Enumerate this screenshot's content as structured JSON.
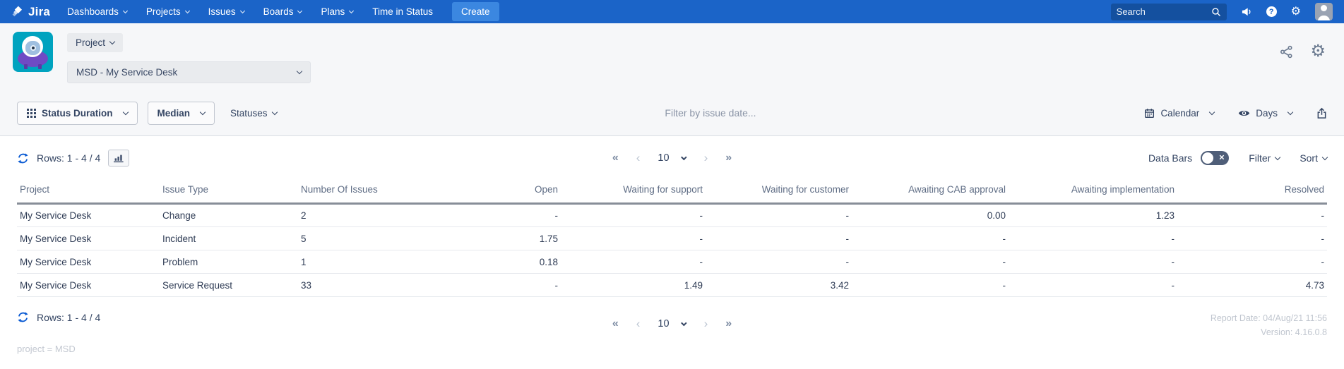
{
  "navbar": {
    "logo_text": "Jira",
    "items": [
      {
        "label": "Dashboards",
        "dropdown": true
      },
      {
        "label": "Projects",
        "dropdown": true
      },
      {
        "label": "Issues",
        "dropdown": true
      },
      {
        "label": "Boards",
        "dropdown": true
      },
      {
        "label": "Plans",
        "dropdown": true
      },
      {
        "label": "Time in Status",
        "dropdown": false
      }
    ],
    "create_label": "Create",
    "search_placeholder": "Search"
  },
  "icons": {
    "help_glyph": "?",
    "gear_glyph": "⚙",
    "cross_glyph": "✕"
  },
  "project_header": {
    "scope_label": "Project",
    "project_value": "MSD - My Service Desk"
  },
  "toolbar": {
    "report_type_label": "Status Duration",
    "metric_label": "Median",
    "statuses_label": "Statuses",
    "date_filter_placeholder": "Filter by issue date...",
    "calendar_label": "Calendar",
    "unit_label": "Days"
  },
  "list_controls": {
    "rows_label": "Rows: 1 - 4 / 4",
    "data_bars_label": "Data Bars",
    "data_bars_state": "off",
    "filter_label": "Filter",
    "sort_label": "Sort"
  },
  "pagination": {
    "first": "«",
    "prev": "‹",
    "page_size": "10",
    "next": "›",
    "last": "»"
  },
  "table": {
    "columns": [
      {
        "label": "Project",
        "align": "left"
      },
      {
        "label": "Issue Type",
        "align": "left"
      },
      {
        "label": "Number Of Issues",
        "align": "left"
      },
      {
        "label": "Open",
        "align": "right"
      },
      {
        "label": "Waiting for support",
        "align": "right"
      },
      {
        "label": "Waiting for customer",
        "align": "right"
      },
      {
        "label": "Awaiting CAB approval",
        "align": "right"
      },
      {
        "label": "Awaiting implementation",
        "align": "right"
      },
      {
        "label": "Resolved",
        "align": "right"
      }
    ],
    "rows": [
      [
        "My Service Desk",
        "Change",
        "2",
        "-",
        "-",
        "-",
        "0.00",
        "1.23",
        "-"
      ],
      [
        "My Service Desk",
        "Incident",
        "5",
        "1.75",
        "-",
        "-",
        "-",
        "-",
        "-"
      ],
      [
        "My Service Desk",
        "Problem",
        "1",
        "0.18",
        "-",
        "-",
        "-",
        "-",
        "-"
      ],
      [
        "My Service Desk",
        "Service Request",
        "33",
        "-",
        "1.49",
        "3.42",
        "-",
        "-",
        "4.73"
      ]
    ]
  },
  "footer": {
    "rows_label": "Rows: 1 - 4 / 4",
    "report_date": "Report Date: 04/Aug/21 11:56",
    "version": "Version: 4.16.0.8",
    "query_text": "project = MSD"
  },
  "colors": {
    "navbar_bg": "#1b64c8",
    "create_button_bg": "#3b87e0",
    "accent_blue": "#0b5bd3",
    "text_dark": "#344563",
    "header_grey": "#5e6c84",
    "muted_grey": "#c0c6cf",
    "project_avatar_teal": "#00a3bf",
    "project_avatar_purple": "#6f4bc4"
  }
}
